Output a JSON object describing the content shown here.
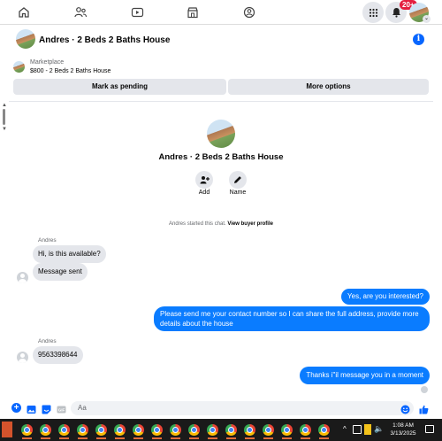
{
  "nav": {
    "badge": "20+"
  },
  "header": {
    "title": "Andres · 2 Beds 2 Baths House",
    "info_glyph": "i"
  },
  "listing": {
    "label": "Marketplace",
    "value": "$800 - 2 Beds 2 Baths House"
  },
  "actions": {
    "pending": "Mark as pending",
    "more": "More options"
  },
  "profile": {
    "title": "Andres · 2 Beds 2 Baths House",
    "add_label": "Add",
    "name_label": "Name",
    "started_text": "Andres started this chat.",
    "buyer_profile": "View buyer profile"
  },
  "messages": [
    {
      "sender": "Andres",
      "text": "Hi, is this available?",
      "dir": "in"
    },
    {
      "text": "Message sent",
      "dir": "in"
    },
    {
      "text": "Yes, are you interested?",
      "dir": "out"
    },
    {
      "text": "Please send me your contact number so I can share the full address, provide more details about the house",
      "dir": "out"
    },
    {
      "sender": "Andres",
      "text": "9563398644",
      "dir": "in"
    },
    {
      "text": "Thanks i\"il message you in a moment",
      "dir": "out"
    }
  ],
  "composer": {
    "placeholder": "Aa"
  },
  "taskbar": {
    "time": "1:08 AM",
    "date": "3/13/2025"
  },
  "colors": {
    "accent": "#0866ff",
    "outgoing_bubble": "#0a7cff",
    "incoming_bubble": "#e4e6eb",
    "badge": "#e41e3f"
  }
}
